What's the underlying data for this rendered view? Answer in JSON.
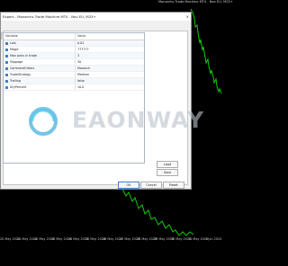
{
  "chart": {
    "window_title": "Monarchs Trade Machine MT4 - Nov EU, M25+",
    "time_labels": [
      "20 May 2024",
      "21 May 2024",
      "22 May 2024",
      "23 May 2024",
      "24 May 2024",
      "25 May 2024",
      "26 May 2024",
      "27 May 2024",
      "28 May 2024",
      "29 May 2024",
      "30 May 2024",
      "31 May 2024",
      "1 Jun 2024"
    ],
    "line_color": "#16c60c"
  },
  "dialog": {
    "title": "Expert - Monarchs Trade Machine MT4 - Nov EU, M25+",
    "tabs": [
      "About",
      "Common",
      "Inputs"
    ],
    "active_tab": "Inputs",
    "table": {
      "header_variable": "Variable",
      "header_value": "Value",
      "rows": [
        {
          "variable": "Lots",
          "value": "0.01"
        },
        {
          "variable": "Magic",
          "value": "777777"
        },
        {
          "variable": "Max pairs in trade",
          "value": "3"
        },
        {
          "variable": "Slippage",
          "value": "30"
        },
        {
          "variable": "CommentOrders",
          "value": "Monarch"
        },
        {
          "variable": "TradeStrategy",
          "value": "Medium"
        },
        {
          "variable": "Trailing",
          "value": "false"
        },
        {
          "variable": "DryPercent",
          "value": "10.0"
        }
      ]
    },
    "buttons": {
      "load": "Load",
      "save": "Save",
      "ok": "OK",
      "cancel": "Cancel",
      "reset": "Reset"
    }
  },
  "watermark": {
    "text": "EAONWAY"
  }
}
